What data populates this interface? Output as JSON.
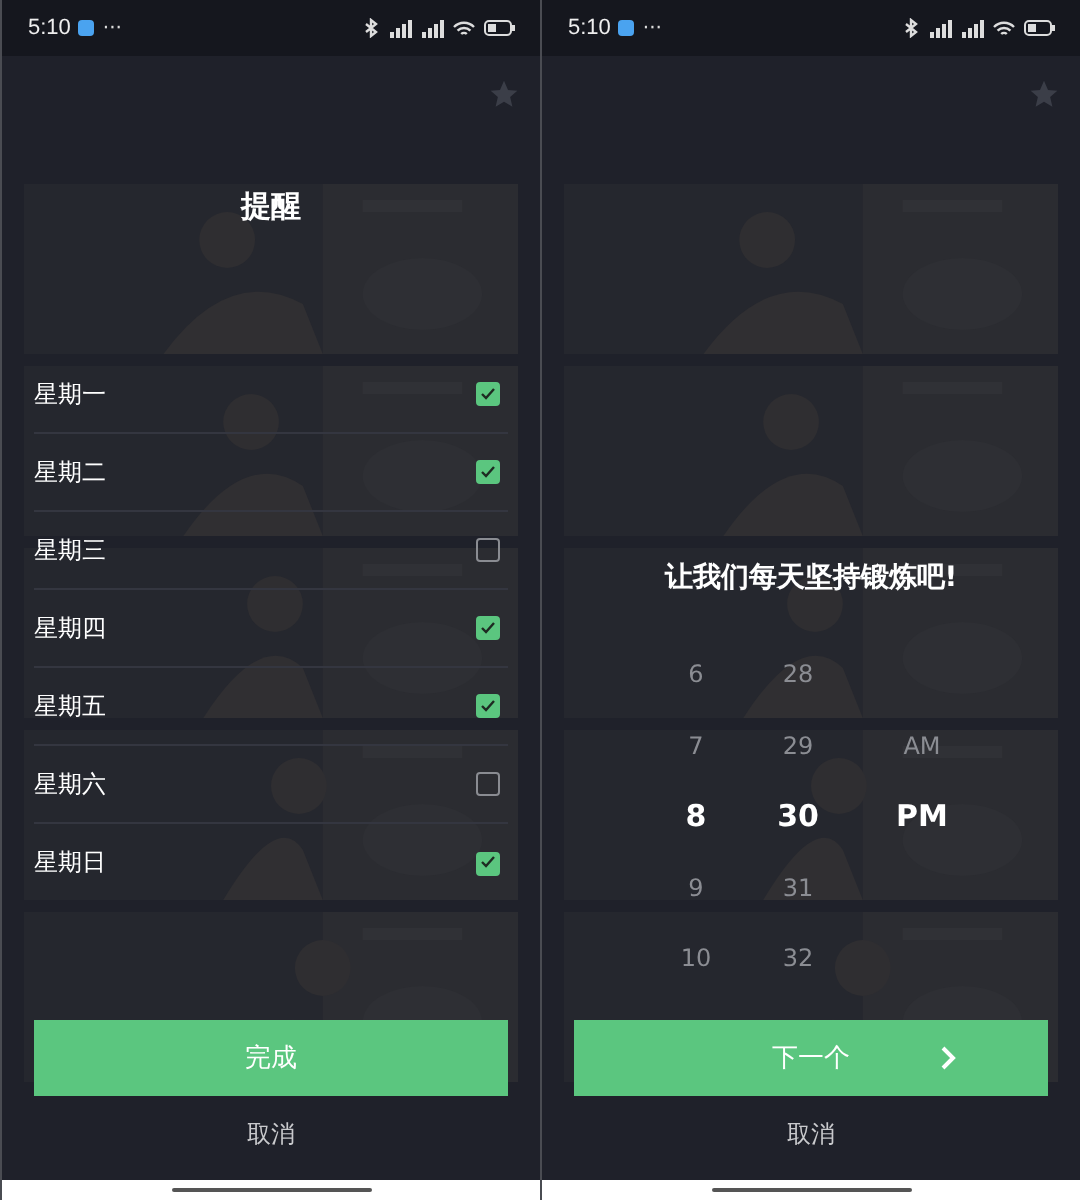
{
  "screens": [
    {
      "status_bar": {
        "time": "5:10",
        "more": "···"
      },
      "dialog": {
        "kind": "reminder",
        "title": "提醒",
        "days": [
          {
            "label": "星期一",
            "checked": true
          },
          {
            "label": "星期二",
            "checked": true
          },
          {
            "label": "星期三",
            "checked": false
          },
          {
            "label": "星期四",
            "checked": true
          },
          {
            "label": "星期五",
            "checked": true
          },
          {
            "label": "星期六",
            "checked": false
          },
          {
            "label": "星期日",
            "checked": true
          }
        ],
        "primary_button": {
          "label": "完成",
          "chevron": false
        },
        "cancel": "取消"
      }
    },
    {
      "status_bar": {
        "time": "5:10",
        "more": "···"
      },
      "dialog": {
        "kind": "time",
        "title": "让我们每天坚持锻炼吧!",
        "hours": [
          {
            "label": "6",
            "selected": false
          },
          {
            "label": "7",
            "selected": false
          },
          {
            "label": "8",
            "selected": true
          },
          {
            "label": "9",
            "selected": false
          },
          {
            "label": "10",
            "selected": false
          }
        ],
        "minutes": [
          {
            "label": "28",
            "selected": false
          },
          {
            "label": "29",
            "selected": false
          },
          {
            "label": "30",
            "selected": true
          },
          {
            "label": "31",
            "selected": false
          },
          {
            "label": "32",
            "selected": false
          }
        ],
        "periods": [
          {
            "label": "AM",
            "selected": false
          },
          {
            "label": "PM",
            "selected": true
          }
        ],
        "primary_button": {
          "label": "下一个",
          "chevron": true
        },
        "cancel": "取消"
      }
    }
  ]
}
